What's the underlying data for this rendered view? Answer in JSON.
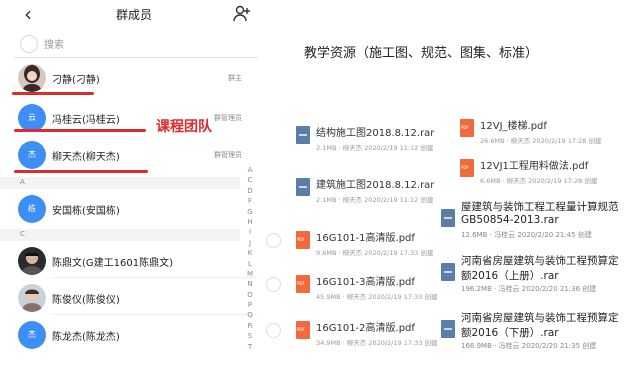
{
  "phone": {
    "title": "群成员",
    "search_placeholder": "搜索",
    "members_top": [
      {
        "name": "刁静(刁静)",
        "role": "群主",
        "avatar": "photo"
      },
      {
        "name": "冯桂云(冯桂云)",
        "role": "群管理员",
        "avatar": "云"
      },
      {
        "name": "柳天杰(柳天杰)",
        "role": "群管理员",
        "avatar": "杰"
      }
    ],
    "team_label": "课程团队",
    "sections": [
      {
        "letter": "A",
        "members": [
          {
            "name": "安国栋(安国栋)",
            "avatar": "栋"
          }
        ]
      },
      {
        "letter": "C",
        "members": [
          {
            "name": "陈鼎文(G建工1601陈鼎文)",
            "avatar": "photo"
          },
          {
            "name": "陈俊仪(陈俊仪)",
            "avatar": "photo"
          },
          {
            "name": "陈龙杰(陈龙杰)",
            "avatar": "杰"
          }
        ]
      }
    ],
    "index_letters": [
      "A",
      "C",
      "D",
      "F",
      "G",
      "H",
      "I",
      "J",
      "K",
      "L",
      "M",
      "N",
      "O",
      "P",
      "Q",
      "R",
      "S",
      "T"
    ],
    "colors": {
      "accent": "#3d8ff5",
      "highlight": "#e02a2a"
    }
  },
  "resources": {
    "heading": "教学资源（施工图、规范、图集、标准）",
    "files_left": [
      {
        "name": "结构施工图2018.8.12.rar",
        "meta": "2.1MB · 柳天杰 2020/2/19 11:12 创建",
        "type": "rar"
      },
      {
        "name": "建筑施工图2018.8.12.rar",
        "meta": "2.1MB · 柳天杰 2020/2/19 11:12 创建",
        "type": "rar"
      },
      {
        "name": "16G101-1高清版.pdf",
        "meta": "9.6MB · 柳天杰 2020/2/19 17:33 创建",
        "type": "pdf"
      },
      {
        "name": "16G101-3高清版.pdf",
        "meta": "45.9MB · 柳天杰 2020/2/19 17:33 创建",
        "type": "pdf"
      },
      {
        "name": "16G101-2高清版.pdf",
        "meta": "34.9MB · 柳天杰 2020/2/19 17:33 创建",
        "type": "pdf"
      }
    ],
    "files_right": [
      {
        "name": "12VJ_楼梯.pdf",
        "meta": "26.6MB · 柳天杰 2020/2/19 17:28 创建",
        "type": "pdf"
      },
      {
        "name": "12VJ1工程用料做法.pdf",
        "meta": "6.6MB · 柳天杰 2020/2/19 17:28 创建",
        "type": "pdf"
      }
    ],
    "files_big": [
      {
        "name1": "屋建筑与装饰工程工程量计算规范",
        "name2": "GB50854-2013.rar",
        "meta": "12.6MB · 冯桂云 2020/2/20 21:45 创建",
        "type": "rar"
      },
      {
        "name1": "河南省房屋建筑与装饰工程预算定",
        "name2": "额2016（上册）.rar",
        "meta": "196.2MB · 冯桂云 2020/2/20 21:36 创建",
        "type": "rar"
      },
      {
        "name1": "河南省房屋建筑与装饰工程预算定",
        "name2": "额2016（下册）.rar",
        "meta": "166.9MB · 冯桂云 2020/2/20 21:35 创建",
        "type": "rar"
      }
    ]
  }
}
